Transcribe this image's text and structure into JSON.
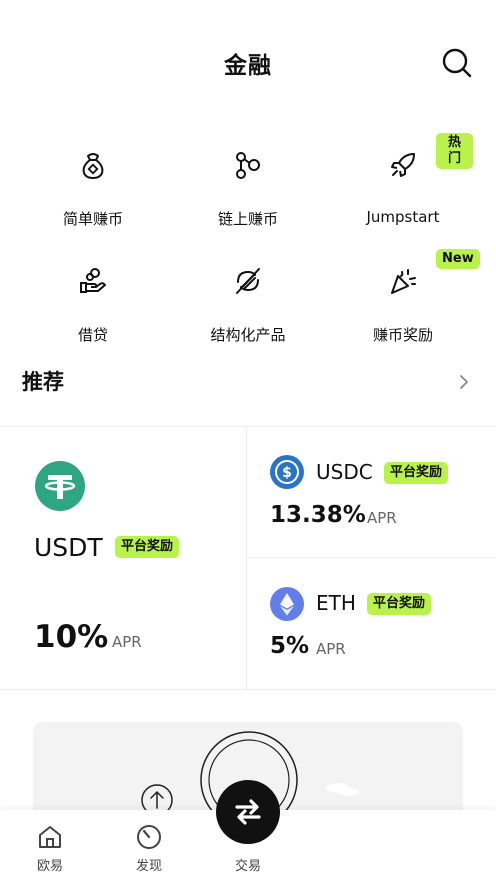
{
  "header": {
    "title": "金融",
    "search_icon": "search-icon"
  },
  "grid": {
    "items": [
      {
        "label": "简单赚币",
        "icon": "money-bag-icon",
        "badge": ""
      },
      {
        "label": "链上赚币",
        "icon": "chain-nodes-icon",
        "badge": ""
      },
      {
        "label": "Jumpstart",
        "icon": "rocket-icon",
        "badge": "热门"
      },
      {
        "label": "借贷",
        "icon": "loan-hand-icon",
        "badge": ""
      },
      {
        "label": "结构化产品",
        "icon": "structured-product-icon",
        "badge": ""
      },
      {
        "label": "赚币奖励",
        "icon": "party-popper-icon",
        "badge": "New"
      }
    ]
  },
  "recommend": {
    "title": "推荐"
  },
  "cards": {
    "usdt": {
      "name": "USDT",
      "badge": "平台奖励",
      "rate": "10%",
      "apr": "APR",
      "color": "#2fa683"
    },
    "usdc": {
      "name": "USDC",
      "badge": "平台奖励",
      "rate": "13.38%",
      "apr": "APR",
      "color": "#2a74c8"
    },
    "eth": {
      "name": "ETH",
      "badge": "平台奖励",
      "rate": "5%",
      "apr": "APR",
      "color": "#627eea"
    }
  },
  "tabbar": {
    "tabs": [
      {
        "label": "欧易",
        "icon": "home-icon"
      },
      {
        "label": "发现",
        "icon": "discover-icon"
      },
      {
        "label": "交易",
        "icon": "swap-icon"
      }
    ]
  },
  "colors": {
    "accent": "#b8f24a",
    "text": "#111111",
    "muted": "#666666"
  }
}
